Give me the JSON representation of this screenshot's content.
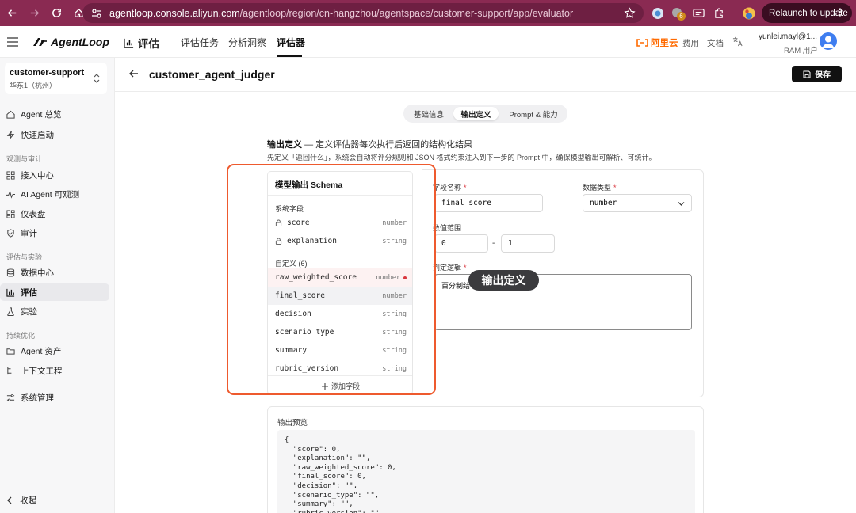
{
  "browser": {
    "url_host": "agentloop.console.aliyun.com",
    "url_path": "/agentloop/region/cn-hangzhou/agentspace/customer-support/app/evaluator",
    "ext_badge": "6",
    "relaunch_label": "Relaunch to update",
    "chrome_color": "#8a2a52"
  },
  "header": {
    "logo": "AgentLoop",
    "section": "评估",
    "tabs": [
      "评估任务",
      "分析洞察",
      "评估器"
    ],
    "active_tab": "评估器",
    "brand": "阿里云",
    "links": [
      "费用",
      "文档"
    ],
    "user_email": "yunlei.mayl@1...",
    "user_role": "RAM 用户"
  },
  "sidebar": {
    "workspace_name": "customer-support",
    "workspace_region": "华东1（杭州）",
    "items": [
      {
        "label": "Agent 总览",
        "icon": "home-icon"
      },
      {
        "label": "快速启动",
        "icon": "lightning-icon"
      },
      {
        "group": "观测与审计"
      },
      {
        "label": "接入中心",
        "icon": "grid-icon"
      },
      {
        "label": "AI Agent 可观测",
        "icon": "pulse-icon"
      },
      {
        "label": "仪表盘",
        "icon": "dashboard-icon"
      },
      {
        "label": "审计",
        "icon": "shield-icon"
      },
      {
        "group": "评估与实验"
      },
      {
        "label": "数据中心",
        "icon": "database-icon"
      },
      {
        "label": "评估",
        "icon": "bar-chart-icon",
        "active": true
      },
      {
        "label": "实验",
        "icon": "flask-icon"
      },
      {
        "group": "持续优化"
      },
      {
        "label": "Agent 资产",
        "icon": "folder-icon"
      },
      {
        "label": "上下文工程",
        "icon": "context-icon"
      },
      {
        "label": "系统管理",
        "icon": "settings-icon"
      }
    ],
    "collapse_label": "收起"
  },
  "page": {
    "title": "customer_agent_judger",
    "save_label": "保存",
    "segments": [
      "基础信息",
      "输出定义",
      "Prompt & 能力"
    ],
    "active_segment": "输出定义",
    "section_title": "输出定义",
    "section_subtitle": "— 定义评估器每次执行后返回的结构化结果",
    "section_desc": "先定义「返回什么」，系统会自动将评分规则和 JSON 格式约束注入到下一步的 Prompt 中，确保模型输出可解析、可统计。"
  },
  "schema": {
    "title": "模型输出 Schema",
    "system_group": "系统字段",
    "system_fields": [
      {
        "name": "score",
        "type": "number"
      },
      {
        "name": "explanation",
        "type": "string"
      }
    ],
    "custom_group": "自定义 (6)",
    "custom_fields": [
      {
        "name": "raw_weighted_score",
        "type": "number",
        "error": true
      },
      {
        "name": "final_score",
        "type": "number",
        "selected": true
      },
      {
        "name": "decision",
        "type": "string"
      },
      {
        "name": "scenario_type",
        "type": "string"
      },
      {
        "name": "summary",
        "type": "string"
      },
      {
        "name": "rubric_version",
        "type": "string"
      }
    ],
    "add_label": "添加字段"
  },
  "editor": {
    "field_name_label": "字段名称",
    "field_name_value": "final_score",
    "data_type_label": "数据类型",
    "data_type_value": "number",
    "range_label": "数值范围",
    "range_min": "0",
    "range_max": "1",
    "range_sep": "-",
    "logic_label": "判定逻辑",
    "logic_value": "百分制结"
  },
  "preview": {
    "title": "输出预览",
    "code": "{\n  \"score\": 0,\n  \"explanation\": \"\",\n  \"raw_weighted_score\": 0,\n  \"final_score\": 0,\n  \"decision\": \"\",\n  \"scenario_type\": \"\",\n  \"summary\": \"\",\n  \"rubric_version\": \"\""
  },
  "overlay": {
    "tooltip": "输出定义",
    "highlight_color": "#ee5a2e"
  }
}
